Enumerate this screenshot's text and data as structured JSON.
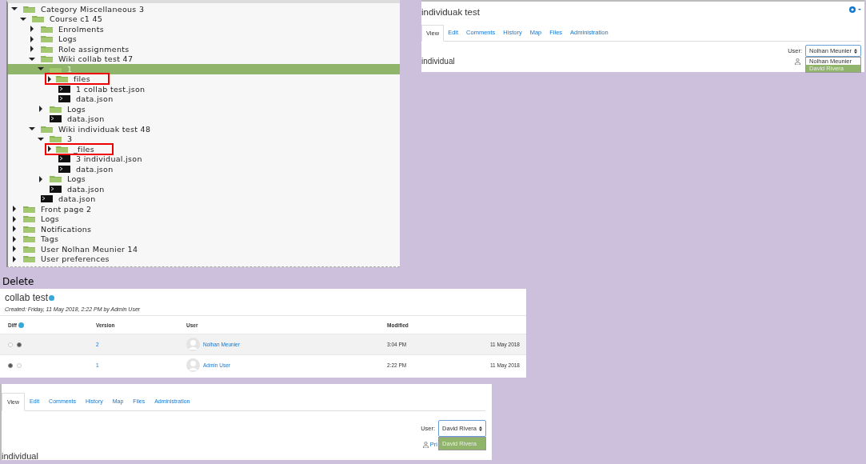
{
  "tree": {
    "items": [
      {
        "label": "Category Miscellaneous 3",
        "kind": "folder",
        "expanded": true,
        "selected": false,
        "highlighted": false,
        "children": [
          {
            "label": "Course c1 45",
            "kind": "folder",
            "expanded": true,
            "selected": false,
            "highlighted": false,
            "children": [
              {
                "label": "Enrolments",
                "kind": "folder",
                "expanded": false,
                "selected": false,
                "highlighted": false
              },
              {
                "label": "Logs",
                "kind": "folder",
                "expanded": false,
                "selected": false,
                "highlighted": false
              },
              {
                "label": "Role assignments",
                "kind": "folder",
                "expanded": false,
                "selected": false,
                "highlighted": false
              },
              {
                "label": "Wiki collab test 47",
                "kind": "folder",
                "expanded": true,
                "selected": false,
                "highlighted": false,
                "children": [
                  {
                    "label": "1",
                    "kind": "folder",
                    "expanded": true,
                    "selected": true,
                    "highlighted": false,
                    "children": [
                      {
                        "label": "files",
                        "kind": "folder",
                        "expanded": false,
                        "selected": false,
                        "highlighted": true
                      },
                      {
                        "label": "1 collab test.json",
                        "kind": "file",
                        "selected": false,
                        "highlighted": false
                      },
                      {
                        "label": "data.json",
                        "kind": "file",
                        "selected": false,
                        "highlighted": false
                      }
                    ]
                  },
                  {
                    "label": "Logs",
                    "kind": "folder",
                    "expanded": false,
                    "selected": false,
                    "highlighted": false
                  },
                  {
                    "label": "data.json",
                    "kind": "file",
                    "selected": false,
                    "highlighted": false
                  }
                ]
              },
              {
                "label": "Wiki individuak test 48",
                "kind": "folder",
                "expanded": true,
                "selected": false,
                "highlighted": false,
                "children": [
                  {
                    "label": "3",
                    "kind": "folder",
                    "expanded": true,
                    "selected": false,
                    "highlighted": false,
                    "children": [
                      {
                        "label": "_files",
                        "kind": "folder",
                        "expanded": false,
                        "selected": false,
                        "highlighted": true
                      },
                      {
                        "label": "3 individual.json",
                        "kind": "file",
                        "selected": false,
                        "highlighted": false
                      },
                      {
                        "label": "data.json",
                        "kind": "file",
                        "selected": false,
                        "highlighted": false
                      }
                    ]
                  },
                  {
                    "label": "Logs",
                    "kind": "folder",
                    "expanded": false,
                    "selected": false,
                    "highlighted": false
                  },
                  {
                    "label": "data.json",
                    "kind": "file",
                    "selected": false,
                    "highlighted": false
                  }
                ]
              },
              {
                "label": "data.json",
                "kind": "file",
                "selected": false,
                "highlighted": false
              }
            ]
          }
        ]
      },
      {
        "label": "Front page 2",
        "kind": "folder",
        "expanded": false,
        "selected": false,
        "highlighted": false
      },
      {
        "label": "Logs",
        "kind": "folder",
        "expanded": false,
        "selected": false,
        "highlighted": false
      },
      {
        "label": "Notifications",
        "kind": "folder",
        "expanded": false,
        "selected": false,
        "highlighted": false
      },
      {
        "label": "Tags",
        "kind": "folder",
        "expanded": false,
        "selected": false,
        "highlighted": false
      },
      {
        "label": "User Nolhan Meunier 14",
        "kind": "folder",
        "expanded": false,
        "selected": false,
        "highlighted": false
      },
      {
        "label": "User preferences",
        "kind": "folder",
        "expanded": false,
        "selected": false,
        "highlighted": false
      }
    ]
  },
  "wiki_page_top": {
    "title": "individuak test",
    "tabs": [
      {
        "label": "View",
        "selected": true
      },
      {
        "label": "Edit",
        "selected": false
      },
      {
        "label": "Comments",
        "selected": false
      },
      {
        "label": "History",
        "selected": false
      },
      {
        "label": "Map",
        "selected": false
      },
      {
        "label": "Files",
        "selected": false
      },
      {
        "label": "Administration",
        "selected": false
      }
    ],
    "user_label": "User:",
    "user_select": "Nolhan Meunier",
    "user_options": [
      {
        "label": "Nolhan Meunier",
        "selected": false
      },
      {
        "label": "David Rivera",
        "selected": true
      }
    ],
    "heading": "individual"
  },
  "caption": "Delete",
  "history": {
    "title": "collab test",
    "created": "Created: Friday, 11 May 2018, 2:22 PM by Admin User",
    "columns": [
      "Diff",
      "Version",
      "User",
      "Modified"
    ],
    "rows": [
      {
        "from_checked": false,
        "to_checked": true,
        "version": "2",
        "user": "Nolhan Meunier",
        "time": "3:04 PM",
        "date": "11 May 2018"
      },
      {
        "from_checked": true,
        "to_checked": false,
        "version": "1",
        "user": "Admin User",
        "time": "2:22 PM",
        "date": "11 May 2018"
      }
    ]
  },
  "wiki_page_bottom": {
    "tabs": [
      {
        "label": "View",
        "selected": true
      },
      {
        "label": "Edit",
        "selected": false
      },
      {
        "label": "Comments",
        "selected": false
      },
      {
        "label": "History",
        "selected": false
      },
      {
        "label": "Map",
        "selected": false
      },
      {
        "label": "Files",
        "selected": false
      },
      {
        "label": "Administration",
        "selected": false
      }
    ],
    "user_label": "User:",
    "user_select": "David Rivera",
    "user_options": [
      {
        "label": "David Rivera",
        "selected": true
      }
    ],
    "link_fragment": "Pri",
    "heading": "individual"
  }
}
